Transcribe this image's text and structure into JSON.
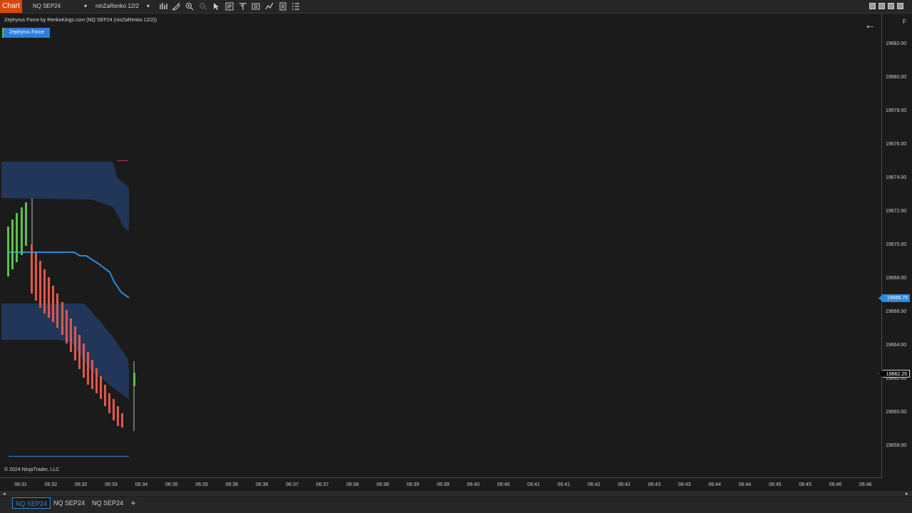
{
  "toolbar": {
    "chart_tab": "Chart",
    "instrument": "NQ SEP24",
    "bar_type": "ninZaRenko 12/2",
    "icons": [
      "bar-type-icon",
      "drawing-tool-icon",
      "zoom-in-icon",
      "zoom-out-icon",
      "pointer-icon",
      "data-box-icon",
      "chart-trader-icon",
      "properties-icon",
      "strategy-icon",
      "print-icon",
      "list-icon"
    ],
    "window_controls": [
      "minimize-icon",
      "restore-icon",
      "maximize-icon",
      "close-icon"
    ]
  },
  "chart": {
    "header": "Zephyrus Force by RenkoKings.com (NQ SEP24 (ninZaRenko 12/2))",
    "indicator_badge": "Zephyrus Force",
    "copyright": "© 2024 NinjaTrader, LLC",
    "back_arrow": "←",
    "f_label": "F",
    "colors": {
      "up_bar": "#5fbf4f",
      "down_bar": "#e0574a",
      "cloud": "#24406e",
      "midline": "#2d8bd8",
      "lower_line": "#2d6fb8"
    }
  },
  "price_axis": {
    "labels": [
      "19682.00",
      "19680.00",
      "19678.00",
      "19676.00",
      "19674.00",
      "19672.00",
      "19670.00",
      "19668.00",
      "19666.00",
      "19664.00",
      "19662.00",
      "19660.00",
      "19658.00"
    ],
    "current_marker": "19666.75",
    "last_price_marker": "19662.25"
  },
  "time_axis": {
    "labels": [
      "06:31",
      "06:32",
      "06:32",
      "06:33",
      "06:34",
      "06:35",
      "06:35",
      "06:36",
      "06:36",
      "06:37",
      "06:37",
      "06:38",
      "06:38",
      "06:39",
      "06:39",
      "06:40",
      "06:40",
      "06:41",
      "06:41",
      "06:42",
      "06:42",
      "06:43",
      "06:43",
      "06:44",
      "06:44",
      "06:45",
      "06:45",
      "06:46",
      "06:46"
    ]
  },
  "tabs": [
    "NQ SEP24",
    "NQ SEP24",
    "NQ SEP24"
  ],
  "add_tab": "+"
}
